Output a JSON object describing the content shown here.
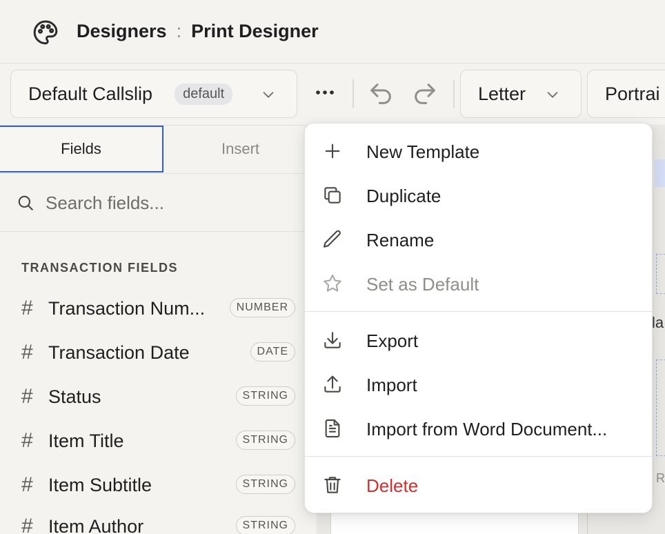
{
  "header": {
    "breadcrumb_root": "Designers",
    "breadcrumb_sep": ":",
    "breadcrumb_current": "Print Designer"
  },
  "toolbar": {
    "template_name": "Default Callslip",
    "template_badge": "default",
    "paper_size": "Letter",
    "orientation": "Portrai"
  },
  "sidebar": {
    "tabs": [
      {
        "label": "Fields",
        "active": true
      },
      {
        "label": "Insert",
        "active": false
      }
    ],
    "search_placeholder": "Search fields...",
    "section_title": "TRANSACTION FIELDS",
    "fields": [
      {
        "name": "Transaction Num...",
        "type": "NUMBER"
      },
      {
        "name": "Transaction Date",
        "type": "DATE"
      },
      {
        "name": "Status",
        "type": "STRING"
      },
      {
        "name": "Item Title",
        "type": "STRING"
      },
      {
        "name": "Item Subtitle",
        "type": "STRING"
      },
      {
        "name": "Item Author",
        "type": "STRING"
      }
    ],
    "field_marker": "#"
  },
  "canvas": {
    "fragment_1": "la",
    "fragment_2": "R"
  },
  "menu": {
    "items": [
      {
        "label": "New Template",
        "icon": "plus-icon"
      },
      {
        "label": "Duplicate",
        "icon": "copy-icon"
      },
      {
        "label": "Rename",
        "icon": "pencil-icon"
      },
      {
        "label": "Set as Default",
        "icon": "star-icon",
        "disabled": true
      },
      {
        "label": "Export",
        "icon": "download-icon"
      },
      {
        "label": "Import",
        "icon": "upload-icon"
      },
      {
        "label": "Import from Word Document...",
        "icon": "document-icon"
      },
      {
        "label": "Delete",
        "icon": "trash-icon",
        "danger": true
      }
    ]
  },
  "colors": {
    "accent": "#2e5bd8",
    "danger": "#d32f2f",
    "background": "#f4f3ef"
  }
}
